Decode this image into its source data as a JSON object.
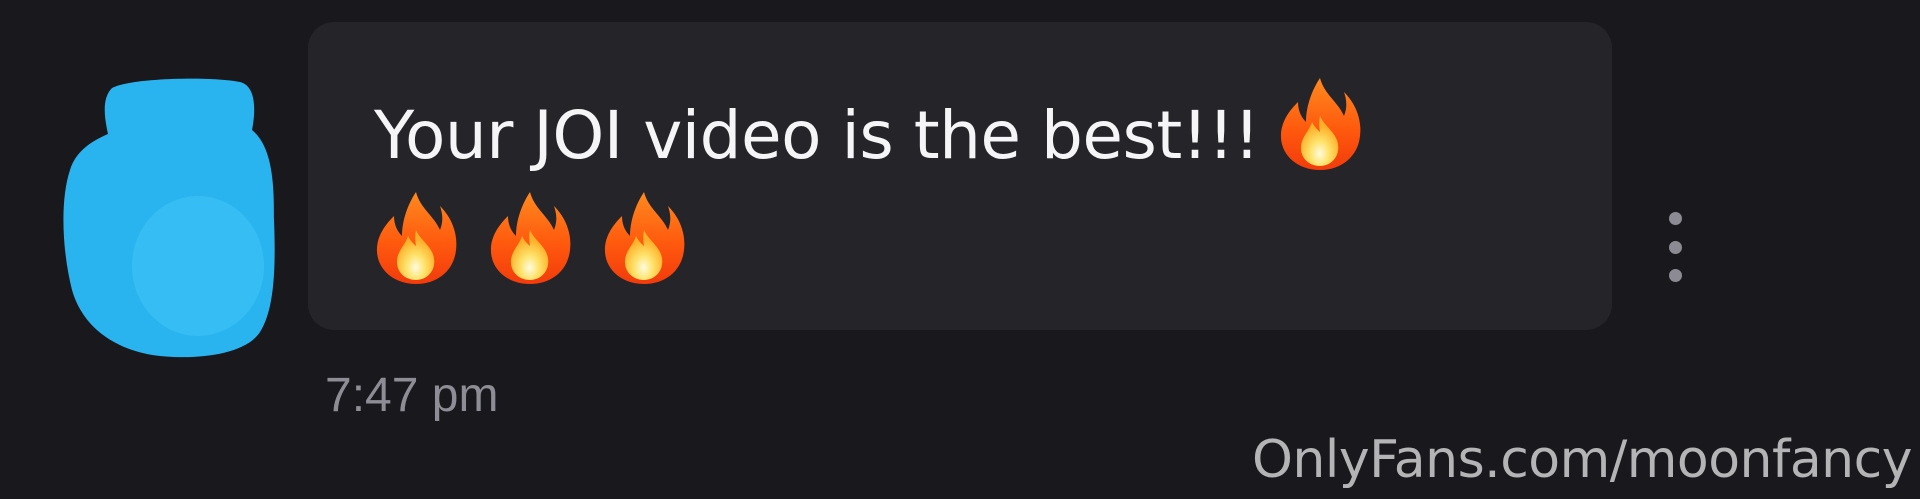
{
  "message": {
    "text": "Your JOI video is the best!!!",
    "emoji_icon": "fire-emoji-icon",
    "emoji_count_inline": 1,
    "emoji_count_next_line": 3,
    "timestamp": "7:47 pm"
  },
  "sender": {
    "avatar_icon": "avatar-icon",
    "avatar_color": "#2ab4ef"
  },
  "actions": {
    "more_icon": "more-vertical-icon"
  },
  "watermark": {
    "text": "OnlyFans.com/moonfancy"
  },
  "colors": {
    "background": "#19181c",
    "bubble": "#252429",
    "text": "#f5f5f7",
    "timestamp": "#8e8d96"
  }
}
